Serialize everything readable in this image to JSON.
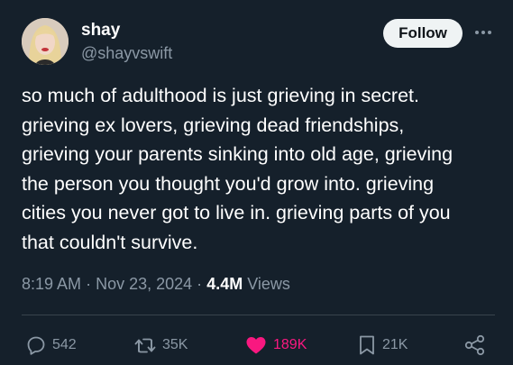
{
  "user": {
    "display_name": "shay",
    "handle": "@shayvswift"
  },
  "follow_label": "Follow",
  "tweet": {
    "text": "so much of adulthood is just grieving in secret.\ngrieving ex lovers, grieving dead friendships,\ngrieving your parents sinking into old age, grieving\nthe person you thought you'd grow into. grieving\ncities you never got to live in. grieving parts of you\nthat couldn't survive."
  },
  "meta": {
    "time": "8:19 AM",
    "separator": "·",
    "date": "Nov 23, 2024",
    "views_count": "4.4M",
    "views_label": "Views"
  },
  "actions": {
    "reply_count": "542",
    "retweet_count": "35K",
    "like_count": "189K",
    "bookmark_count": "21K"
  },
  "colors": {
    "background": "#15202b",
    "secondary_text": "#8b98a5",
    "like": "#f91880",
    "follow_bg": "#eff3f4"
  },
  "icons": [
    "reply-icon",
    "retweet-icon",
    "heart-icon",
    "bookmark-icon",
    "share-icon",
    "more-icon"
  ]
}
